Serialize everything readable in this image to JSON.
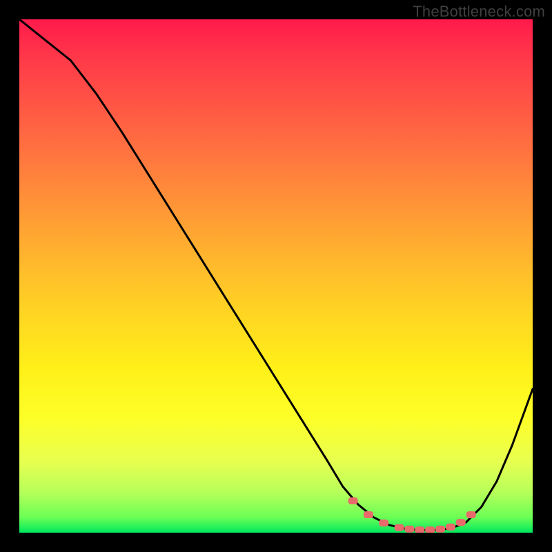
{
  "watermark": "TheBottleneck.com",
  "chart_data": {
    "type": "line",
    "title": "",
    "xlabel": "",
    "ylabel": "",
    "xlim": [
      0,
      100
    ],
    "ylim": [
      0,
      100
    ],
    "series": [
      {
        "name": "bottleneck-curve",
        "x": [
          0,
          5,
          10,
          15,
          20,
          25,
          30,
          35,
          40,
          45,
          50,
          55,
          60,
          63,
          66,
          69,
          72,
          75,
          78,
          81,
          84,
          87,
          90,
          93,
          96,
          100
        ],
        "values": [
          100,
          96,
          92,
          85.5,
          78,
          70,
          62,
          54,
          46,
          38,
          30,
          22,
          14,
          9,
          5.5,
          3,
          1.5,
          0.8,
          0.5,
          0.5,
          0.8,
          2,
          5,
          10,
          17,
          28
        ]
      }
    ],
    "markers": {
      "name": "optimal-range-dots",
      "color": "#e96a6a",
      "x": [
        65,
        68,
        71,
        74,
        76,
        78,
        80,
        82,
        84,
        86,
        88
      ],
      "values": [
        6.2,
        3.5,
        1.9,
        1.0,
        0.7,
        0.55,
        0.55,
        0.7,
        1.1,
        2.0,
        3.5
      ]
    }
  }
}
